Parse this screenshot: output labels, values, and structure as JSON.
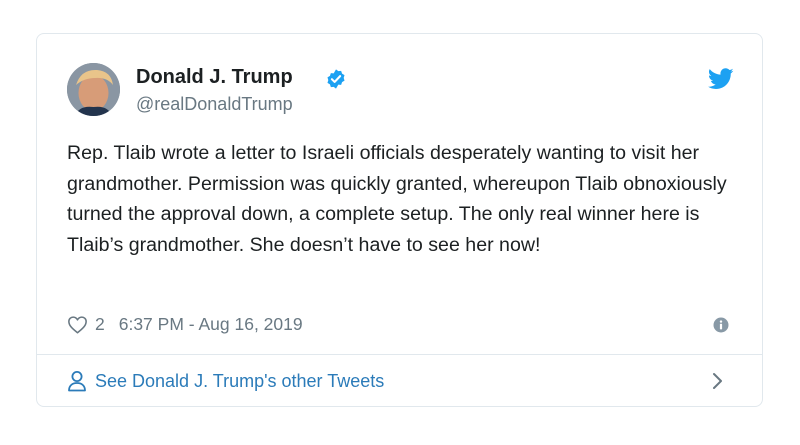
{
  "tweet": {
    "author_name": "Donald J. Trump",
    "handle": "@realDonaldTrump",
    "text": "Rep. Tlaib wrote a letter to Israeli officials desperately wanting to visit her grandmother. Permission was quickly granted, whereupon Tlaib obnoxiously turned the approval down, a complete setup. The only real winner here is Tlaib’s grandmother. She doesn’t have to see her now!",
    "likes": "2",
    "timestamp": "6:37 PM - Aug 16, 2019"
  },
  "footer": {
    "label": "See Donald J. Trump's other Tweets"
  },
  "icons": {
    "verified": "verified-badge-icon",
    "brand": "twitter-bird-icon",
    "like": "heart-icon",
    "info": "info-icon",
    "profile": "user-icon",
    "chevron": "chevron-right-icon"
  },
  "colors": {
    "twitter_blue": "#1da1f2",
    "link_blue": "#2b7bb9",
    "muted_text": "#697882",
    "border": "#e1e8ed"
  }
}
